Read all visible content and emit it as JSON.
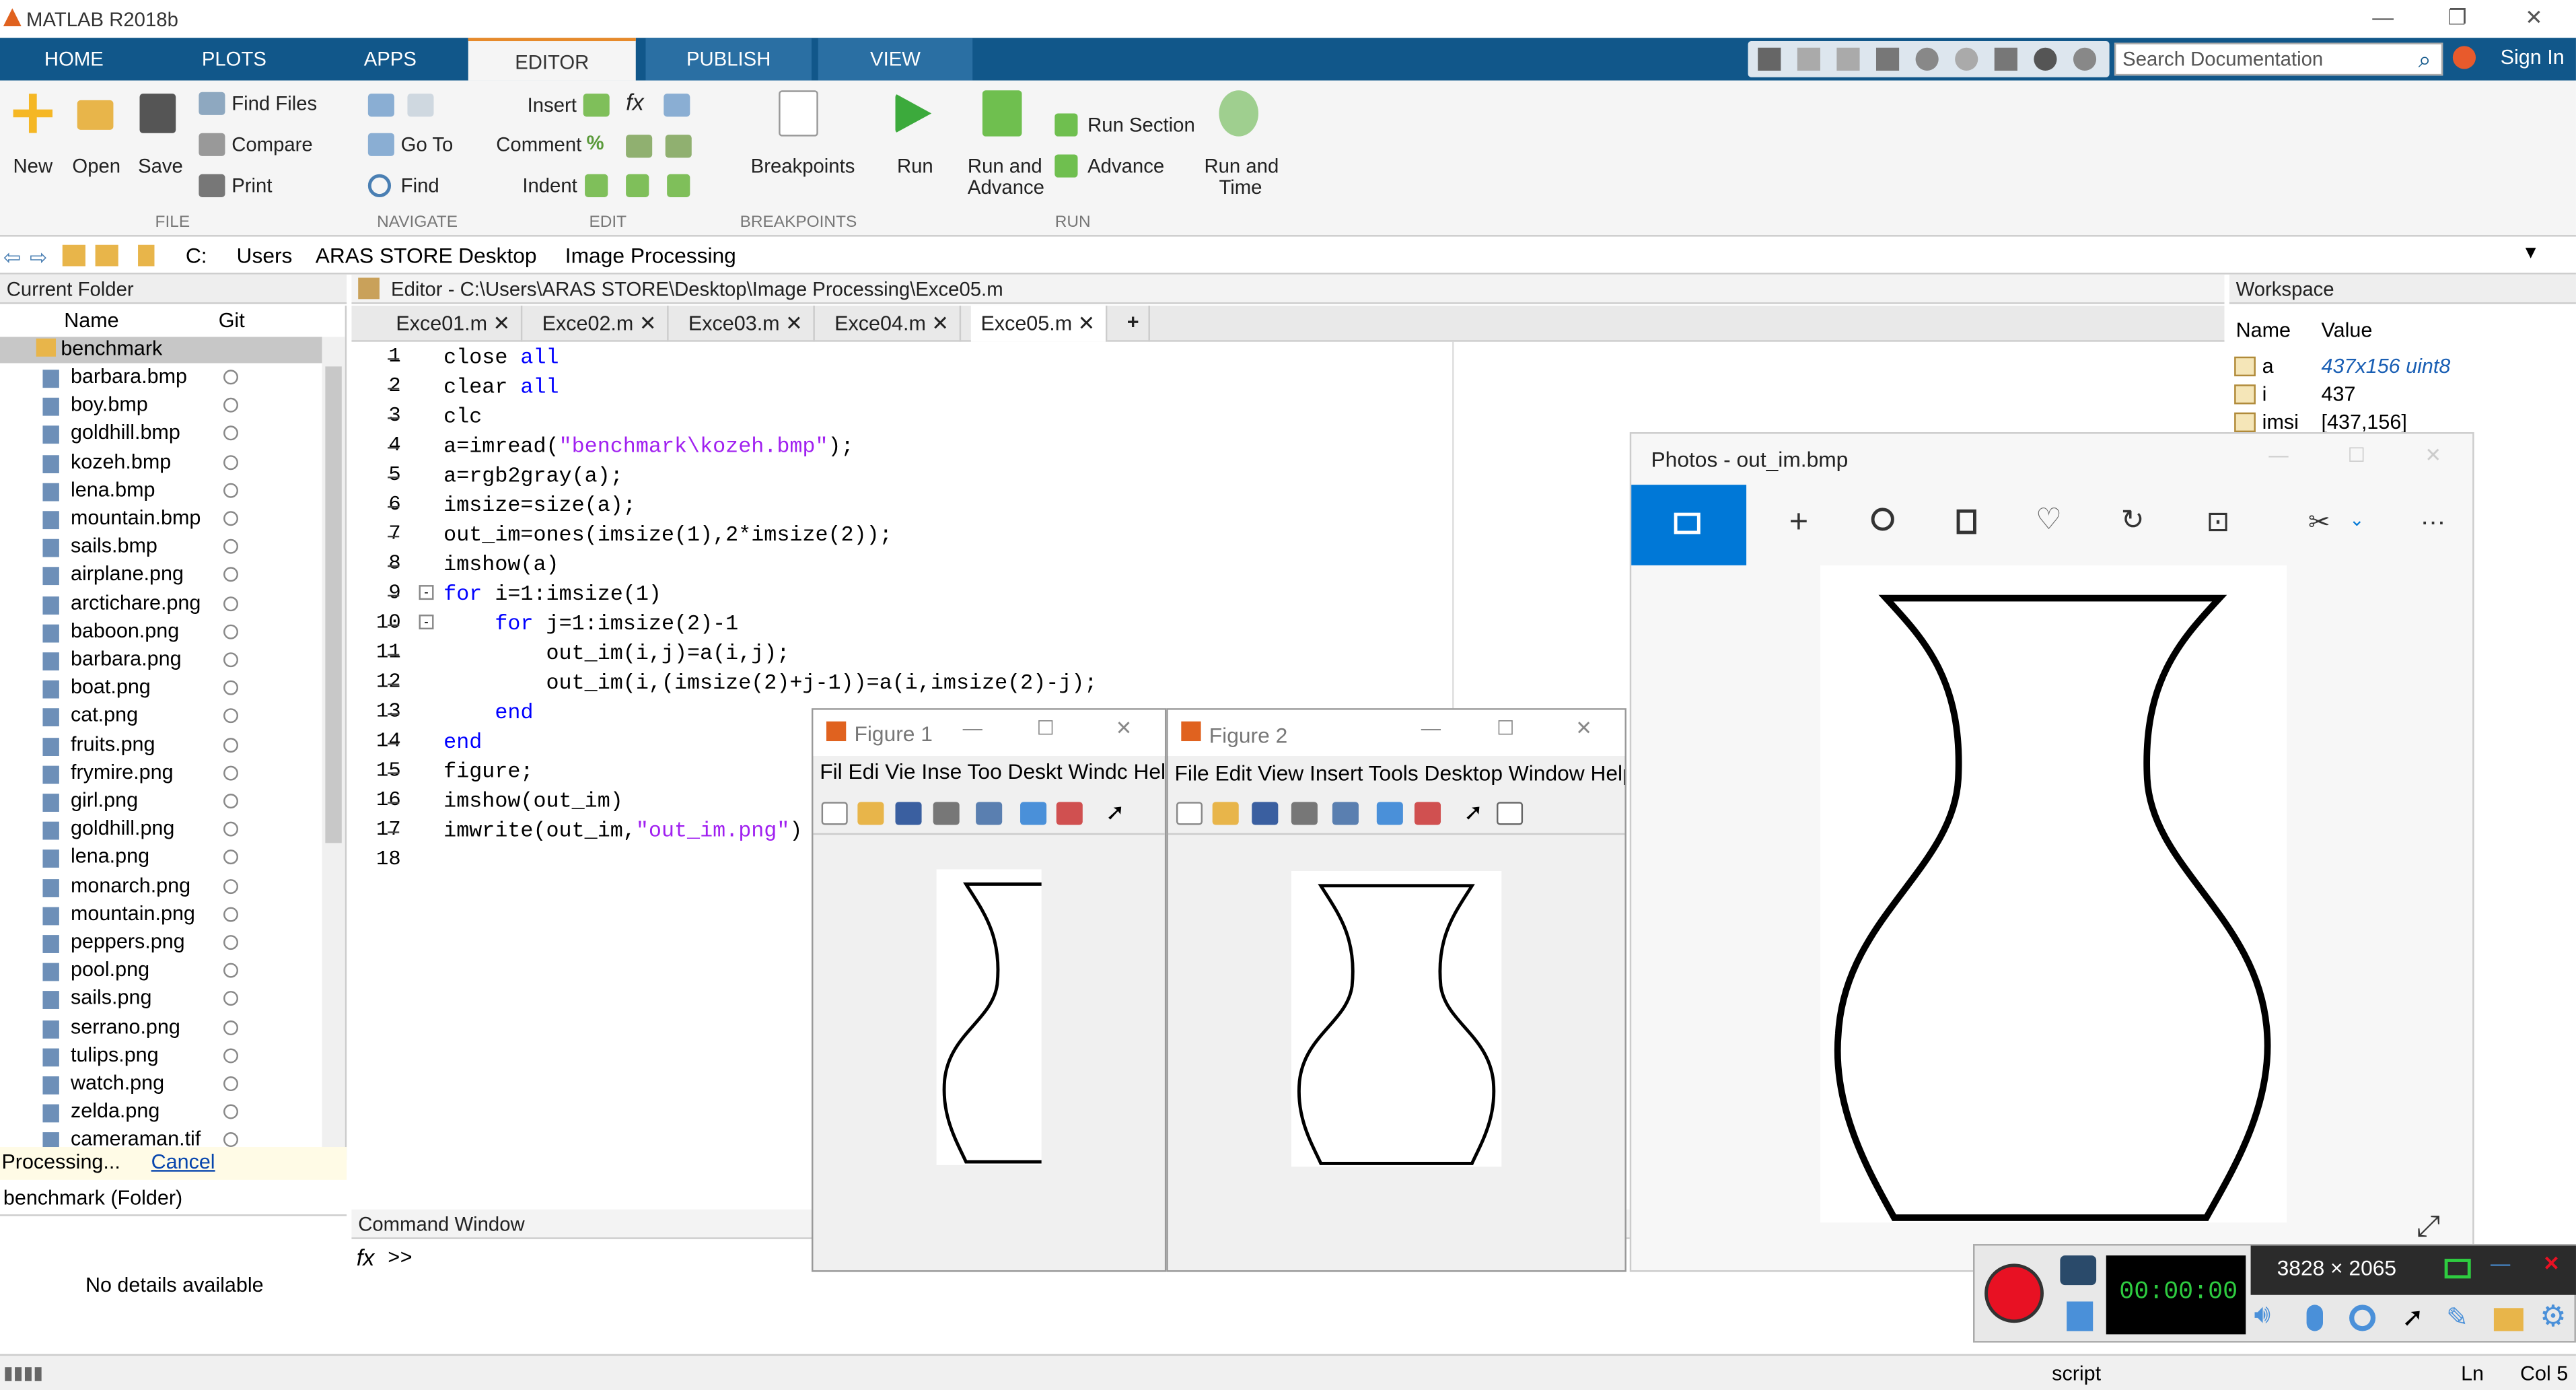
{
  "window": {
    "title": "MATLAB R2018b"
  },
  "ribbon_tabs": [
    "HOME",
    "PLOTS",
    "APPS",
    "EDITOR",
    "PUBLISH",
    "VIEW"
  ],
  "search": {
    "placeholder": "Search Documentation"
  },
  "sign_in": "Sign In",
  "ribbon": {
    "file": {
      "new": "New",
      "open": "Open",
      "save": "Save",
      "find_files": "Find Files",
      "compare": "Compare",
      "print": "Print",
      "group": "FILE"
    },
    "navigate": {
      "go_to": "Go To",
      "find": "Find",
      "group": "NAVIGATE"
    },
    "edit": {
      "insert": "Insert",
      "comment": "Comment",
      "indent": "Indent",
      "group": "EDIT"
    },
    "breakpoints": {
      "label": "Breakpoints",
      "group": "BREAKPOINTS"
    },
    "run": {
      "run": "Run",
      "run_advance_1": "Run and",
      "run_advance_2": "Advance",
      "run_section": "Run Section",
      "advance": "Advance",
      "run_time_1": "Run and",
      "run_time_2": "Time",
      "group": "RUN"
    }
  },
  "address": [
    "C:",
    "Users",
    "ARAS STORE",
    "Desktop",
    "Image Processing"
  ],
  "current_folder": {
    "title": "Current Folder",
    "col_name": "Name",
    "col_git": "Git",
    "root": "benchmark",
    "files": [
      "barbara.bmp",
      "boy.bmp",
      "goldhill.bmp",
      "kozeh.bmp",
      "lena.bmp",
      "mountain.bmp",
      "sails.bmp",
      "airplane.png",
      "arctichare.png",
      "baboon.png",
      "barbara.png",
      "boat.png",
      "cat.png",
      "fruits.png",
      "frymire.png",
      "girl.png",
      "goldhill.png",
      "lena.png",
      "monarch.png",
      "mountain.png",
      "peppers.png",
      "pool.png",
      "sails.png",
      "serrano.png",
      "tulips.png",
      "watch.png",
      "zelda.png",
      "cameraman.tif"
    ],
    "processing": "Processing...",
    "cancel": "Cancel",
    "details_title": "benchmark  (Folder)",
    "no_details": "No details available"
  },
  "editor": {
    "title": "Editor - C:\\Users\\ARAS STORE\\Desktop\\Image Processing\\Exce05.m",
    "tabs": [
      "Exce01.m",
      "Exce02.m",
      "Exce03.m",
      "Exce04.m",
      "Exce05.m"
    ],
    "add_tab": "+",
    "lines": [
      [
        {
          "t": "close ",
          "c": ""
        },
        {
          "t": "all",
          "c": "kw"
        }
      ],
      [
        {
          "t": "clear ",
          "c": ""
        },
        {
          "t": "all",
          "c": "kw"
        }
      ],
      [
        {
          "t": "clc",
          "c": ""
        }
      ],
      [
        {
          "t": "a=imread(",
          "c": ""
        },
        {
          "t": "\"benchmark\\kozeh.bmp\"",
          "c": "str"
        },
        {
          "t": ");",
          "c": ""
        }
      ],
      [
        {
          "t": "a=rgb2gray(a);",
          "c": ""
        }
      ],
      [
        {
          "t": "imsize=size(a);",
          "c": ""
        }
      ],
      [
        {
          "t": "out_im=ones(imsize(1),2*imsize(2));",
          "c": ""
        }
      ],
      [
        {
          "t": "imshow(a)",
          "c": ""
        }
      ],
      [
        {
          "t": "for",
          "c": "kw"
        },
        {
          "t": " i=1:imsize(1)",
          "c": ""
        }
      ],
      [
        {
          "t": "    ",
          "c": ""
        },
        {
          "t": "for",
          "c": "kw"
        },
        {
          "t": " j=1:imsize(2)-1",
          "c": ""
        }
      ],
      [
        {
          "t": "        out_im(i,j)=a(i,j);",
          "c": ""
        }
      ],
      [
        {
          "t": "        out_im(i,(imsize(2)+j-1))=a(i,imsize(2)-j);",
          "c": ""
        }
      ],
      [
        {
          "t": "    ",
          "c": ""
        },
        {
          "t": "end",
          "c": "kw"
        }
      ],
      [
        {
          "t": "end",
          "c": "kw"
        }
      ],
      [
        {
          "t": "figure;",
          "c": ""
        }
      ],
      [
        {
          "t": "imshow(out_im)",
          "c": ""
        }
      ],
      [
        {
          "t": "imwrite(out_im,",
          "c": ""
        },
        {
          "t": "\"out_im.png\"",
          "c": "str"
        },
        {
          "t": ")",
          "c": ""
        }
      ],
      []
    ]
  },
  "command_window": {
    "title": "Command Window",
    "fx": "fx",
    "prompt": ">>"
  },
  "workspace": {
    "title": "Workspace",
    "col_name": "Name",
    "col_value": "Value",
    "rows": [
      {
        "name": "a",
        "value": "437x156 uint8"
      },
      {
        "name": "i",
        "value": "437"
      },
      {
        "name": "imsi",
        "value": "[437,156]"
      }
    ]
  },
  "figure1": {
    "title": "Figure 1",
    "menu": "Fil Edi Vie Inse Too Deskt Windc Hel"
  },
  "figure2": {
    "title": "Figure 2",
    "menu": "File Edit View Insert Tools Desktop Window Help"
  },
  "photos": {
    "title": "Photos - out_im.bmp"
  },
  "recorder": {
    "resolution": "3828 × 2065",
    "timer": "00:00:00"
  },
  "status": {
    "mode": "script",
    "ln": "Ln",
    "col": "Col 5"
  },
  "colors": {
    "ribbon_tab_bar": "#11578a",
    "keyword": "#0000ff",
    "string": "#a020f0",
    "photos_accent": "#0078d7",
    "record": "#e81123"
  }
}
